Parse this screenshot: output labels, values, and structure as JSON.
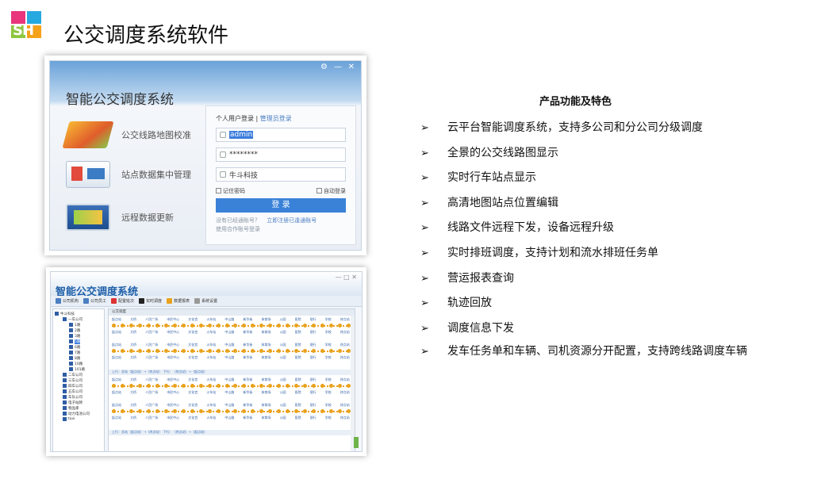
{
  "logo": {
    "text": "SH"
  },
  "page_title": "公交调度系统软件",
  "login_window": {
    "title": "智能公交调度系统",
    "controls": [
      "⚙",
      "—",
      "✕"
    ],
    "features": [
      {
        "icon": "map-icon",
        "label": "公交线路地图校准"
      },
      {
        "icon": "data-icon",
        "label": "站点数据集中管理"
      },
      {
        "icon": "remote-icon",
        "label": "远程数据更新"
      }
    ],
    "login_tabs": {
      "personal": "个人用户登录",
      "admin": "管理员登录"
    },
    "username": "admin",
    "password": "********",
    "company": "牛斗科技",
    "remember_password": "记住密码",
    "auto_login": "自动登录",
    "login_button": "登 录",
    "no_account": "没有已经通账号？",
    "register": "立即注册已逢通账号",
    "partner": "使用合作账号登录"
  },
  "dispatch_window": {
    "title": "智能公交调度系统",
    "toolbar": [
      "公司机构",
      "公司员工",
      "配置班次",
      "实时调度",
      "数据报表",
      "系统设置"
    ],
    "tab": "公交调度",
    "tree": [
      "牛斗科技",
      "一车公司",
      "1路",
      "2路",
      "3路",
      "5路",
      "6路",
      "7路",
      "8路",
      "10路",
      "101路",
      "二车公司",
      "三车公司",
      "四车公司",
      "五车公司",
      "车队公司",
      "电子站牌",
      "物品库",
      "动力电池公司",
      "taxi"
    ],
    "route_stations": [
      "起点站",
      "大桥",
      "人民广场",
      "市民中心",
      "文化宫",
      "火车站",
      "中山路",
      "新华街",
      "体育场",
      "公园",
      "医院",
      "银行",
      "学校",
      "终点站"
    ],
    "route_separator": "上行：总站（起点站）→（终点站）  下行：（终点站）→（起点站）"
  },
  "features": {
    "title": "产品功能及特色",
    "items": [
      "云平台智能调度系统，支持多公司和分公司分级调度",
      "全景的公交线路图显示",
      "实时行车站点显示",
      "高清地图站点位置编辑",
      "线路文件远程下发，设备远程升级",
      "实时排班调度，支持计划和流水排班任务单",
      "营运报表查询",
      "轨迹回放",
      "调度信息下发",
      "发车任务单和车辆、司机资源分开配置，支持跨线路调度车辆"
    ],
    "bullet": "➢"
  },
  "colors": {
    "accent": "#3a82d8",
    "route_orange": "#e8a21c",
    "title_blue": "#1f5fa8"
  }
}
